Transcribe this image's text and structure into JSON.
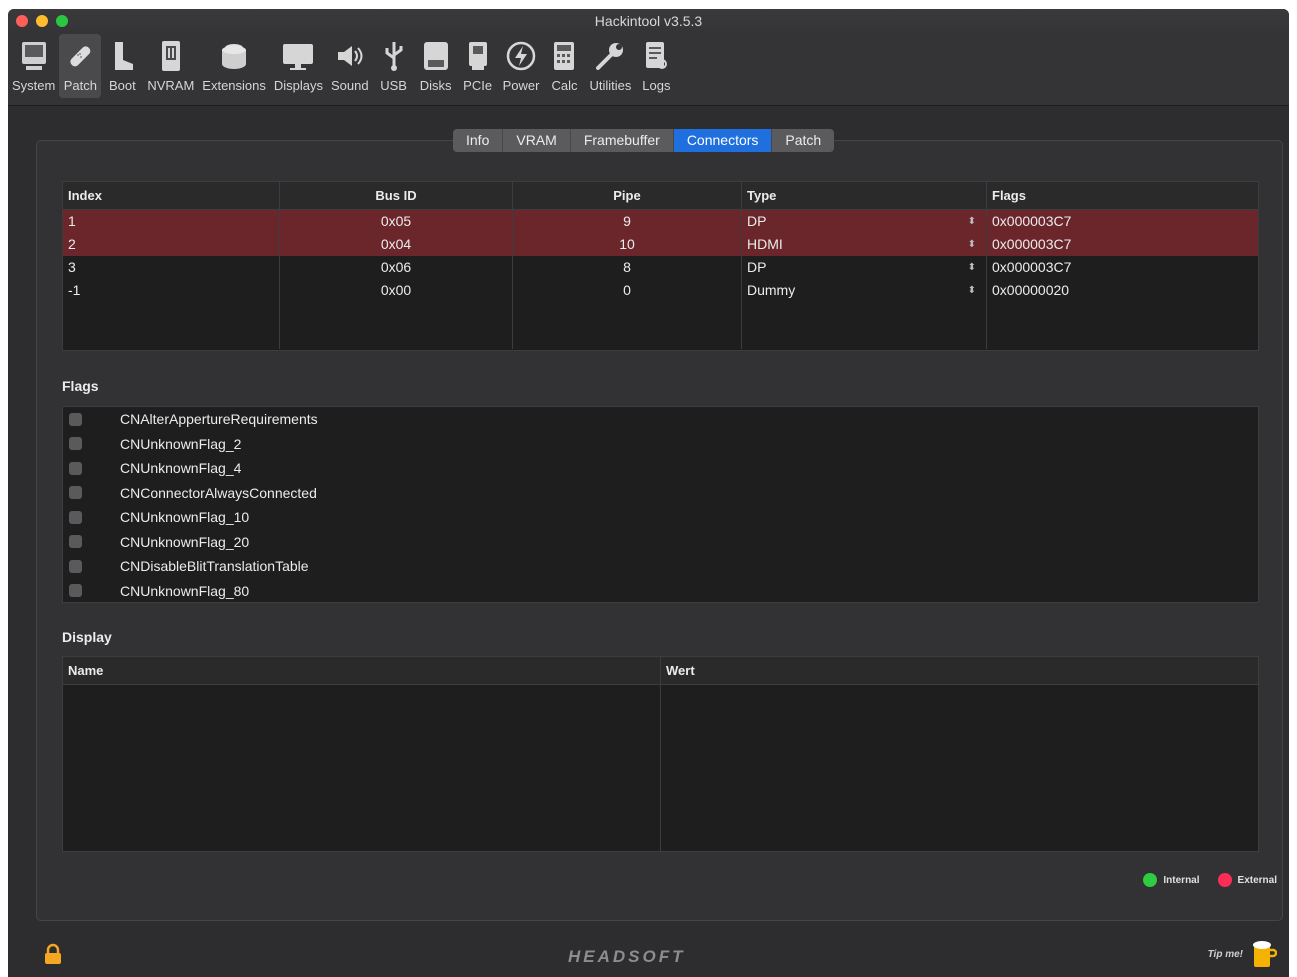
{
  "window": {
    "title": "Hackintool v3.5.3"
  },
  "toolbar": {
    "items": [
      {
        "label": "System",
        "icon": "computer-icon"
      },
      {
        "label": "Patch",
        "icon": "bandage-icon"
      },
      {
        "label": "Boot",
        "icon": "boot-icon"
      },
      {
        "label": "NVRAM",
        "icon": "memory-chip-icon"
      },
      {
        "label": "Extensions",
        "icon": "lego-brick-icon"
      },
      {
        "label": "Displays",
        "icon": "monitor-icon"
      },
      {
        "label": "Sound",
        "icon": "speaker-icon"
      },
      {
        "label": "USB",
        "icon": "usb-icon"
      },
      {
        "label": "Disks",
        "icon": "disk-icon"
      },
      {
        "label": "PCIe",
        "icon": "pcie-card-icon"
      },
      {
        "label": "Power",
        "icon": "lightning-icon"
      },
      {
        "label": "Calc",
        "icon": "calculator-icon"
      },
      {
        "label": "Utilities",
        "icon": "wrench-icon"
      },
      {
        "label": "Logs",
        "icon": "log-document-icon"
      }
    ],
    "active": "Patch"
  },
  "tabs": [
    {
      "label": "Info"
    },
    {
      "label": "VRAM"
    },
    {
      "label": "Framebuffer"
    },
    {
      "label": "Connectors"
    },
    {
      "label": "Patch"
    }
  ],
  "active_tab": "Connectors",
  "connectors": {
    "headers": {
      "index": "Index",
      "bus_id": "Bus ID",
      "pipe": "Pipe",
      "type": "Type",
      "flags": "Flags"
    },
    "rows": [
      {
        "index": "1",
        "bus_id": "0x05",
        "pipe": "9",
        "type": "DP",
        "flags": "0x000003C7",
        "state": "External"
      },
      {
        "index": "2",
        "bus_id": "0x04",
        "pipe": "10",
        "type": "HDMI",
        "flags": "0x000003C7",
        "state": "External"
      },
      {
        "index": "3",
        "bus_id": "0x06",
        "pipe": "8",
        "type": "DP",
        "flags": "0x000003C7",
        "state": ""
      },
      {
        "index": "-1",
        "bus_id": "0x00",
        "pipe": "0",
        "type": "Dummy",
        "flags": "0x00000020",
        "state": ""
      }
    ]
  },
  "flags_section": {
    "title": "Flags",
    "items": [
      {
        "label": "CNAlterAppertureRequirements",
        "checked": false
      },
      {
        "label": "CNUnknownFlag_2",
        "checked": false
      },
      {
        "label": "CNUnknownFlag_4",
        "checked": false
      },
      {
        "label": "CNConnectorAlwaysConnected",
        "checked": false
      },
      {
        "label": "CNUnknownFlag_10",
        "checked": false
      },
      {
        "label": "CNUnknownFlag_20",
        "checked": false
      },
      {
        "label": "CNDisableBlitTranslationTable",
        "checked": false
      },
      {
        "label": "CNUnknownFlag_80",
        "checked": false
      }
    ]
  },
  "display_section": {
    "title": "Display",
    "headers": {
      "name": "Name",
      "value": "Wert"
    }
  },
  "legend": {
    "internal": {
      "label": "Internal",
      "color": "#2ecc40"
    },
    "external": {
      "label": "External",
      "color": "#fe2d55"
    }
  },
  "footer": {
    "brand": "HEADSOFT",
    "tip": "Tip me!"
  },
  "colors": {
    "accent": "#1f6fde",
    "selected_row": "#6b262b"
  }
}
